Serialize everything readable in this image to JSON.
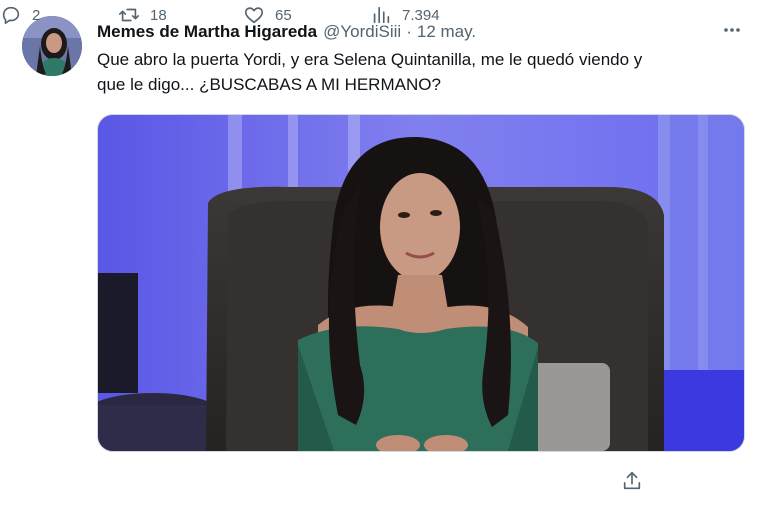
{
  "tweet": {
    "author_name": "Memes de Martha Higareda",
    "handle": "@YordiSiii",
    "separator": "·",
    "date": "12 may.",
    "text_line1": "Que abro la puerta Yordi, y era Selena Quintanilla, me le quedó viendo y",
    "text_line2": "que le digo... ¿BUSCABAS A MI HERMANO?"
  },
  "actions": {
    "replies": "2",
    "retweets": "18",
    "likes": "65",
    "views": "7.394"
  },
  "icons": {
    "avatar": "profile-avatar",
    "more": "more-icon",
    "reply": "reply-icon",
    "retweet": "retweet-icon",
    "like": "heart-icon",
    "views": "views-icon",
    "share": "share-icon"
  },
  "colors": {
    "text": "#0f1419",
    "secondary": "#536471",
    "media_background": "#6f6cf0"
  }
}
